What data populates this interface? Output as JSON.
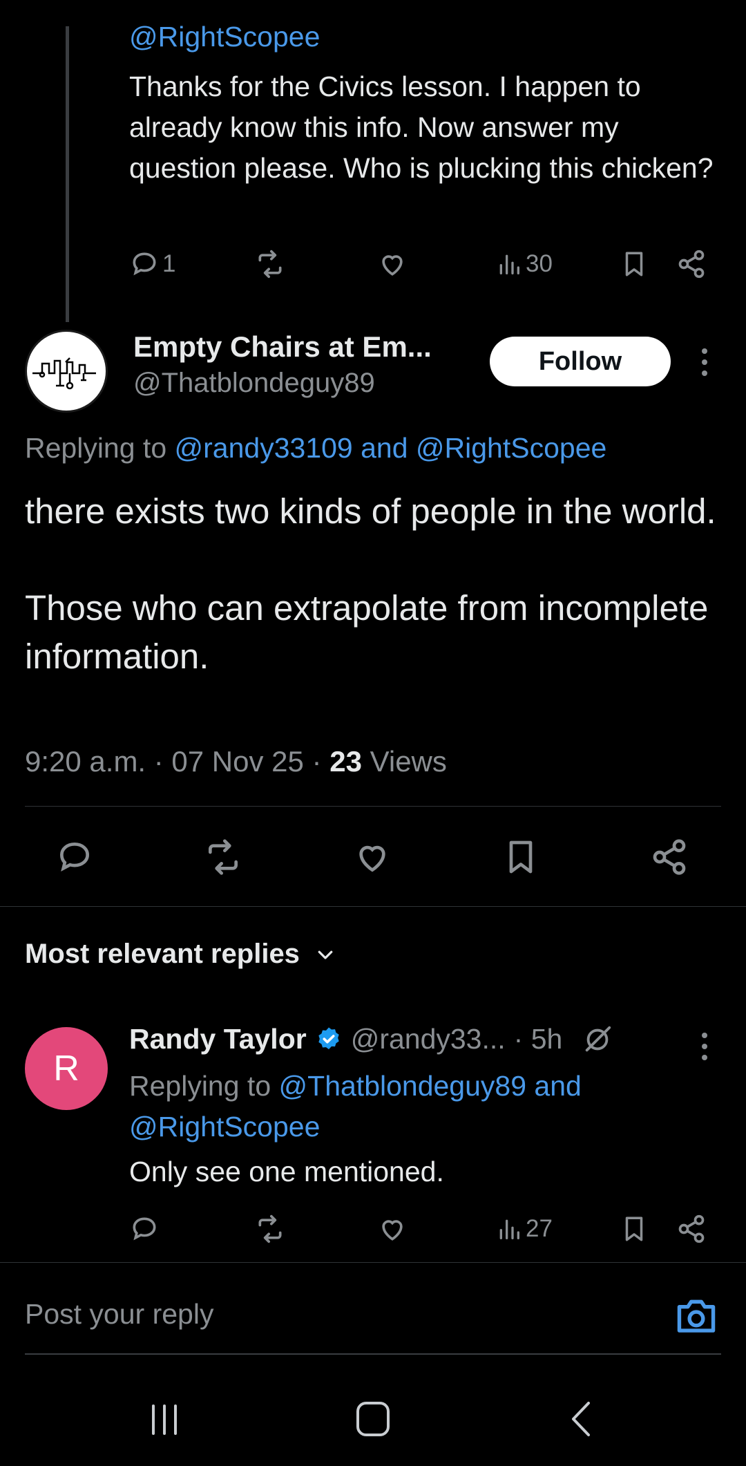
{
  "top_reply": {
    "mention": "@RightScopee",
    "text": "Thanks for the Civics lesson. I happen to already know this info. Now answer my question please. Who is plucking this chicken?",
    "reply_count": "1",
    "views": "30"
  },
  "main_tweet": {
    "name": "Empty Chairs at Em...",
    "handle": "@Thatblondeguy89",
    "follow_label": "Follow",
    "replying_prefix": "Replying to",
    "replying_mentions": "@randy33109 and @RightScopee",
    "text_line1": "there exists two kinds of people in the world.",
    "text_line2": "Those who can extrapolate from incomplete information.",
    "time": "9:20 a.m. · 07 Nov 25 · ",
    "views_count": "23",
    "views_label": " Views"
  },
  "replies_section": {
    "title": "Most relevant replies"
  },
  "reply": {
    "avatar_letter": "R",
    "name": "Randy Taylor",
    "handle": "@randy33...",
    "time": "· 5h",
    "replying_prefix": "Replying to",
    "replying_mentions": "@Thatblondeguy89 and @RightScopee",
    "text": "Only see one mentioned.",
    "views": "27"
  },
  "composer": {
    "placeholder": "Post your reply"
  },
  "colors": {
    "accent": "#4a99e9",
    "verified": "#1d9bf0",
    "avatar_r": "#e3487a"
  }
}
